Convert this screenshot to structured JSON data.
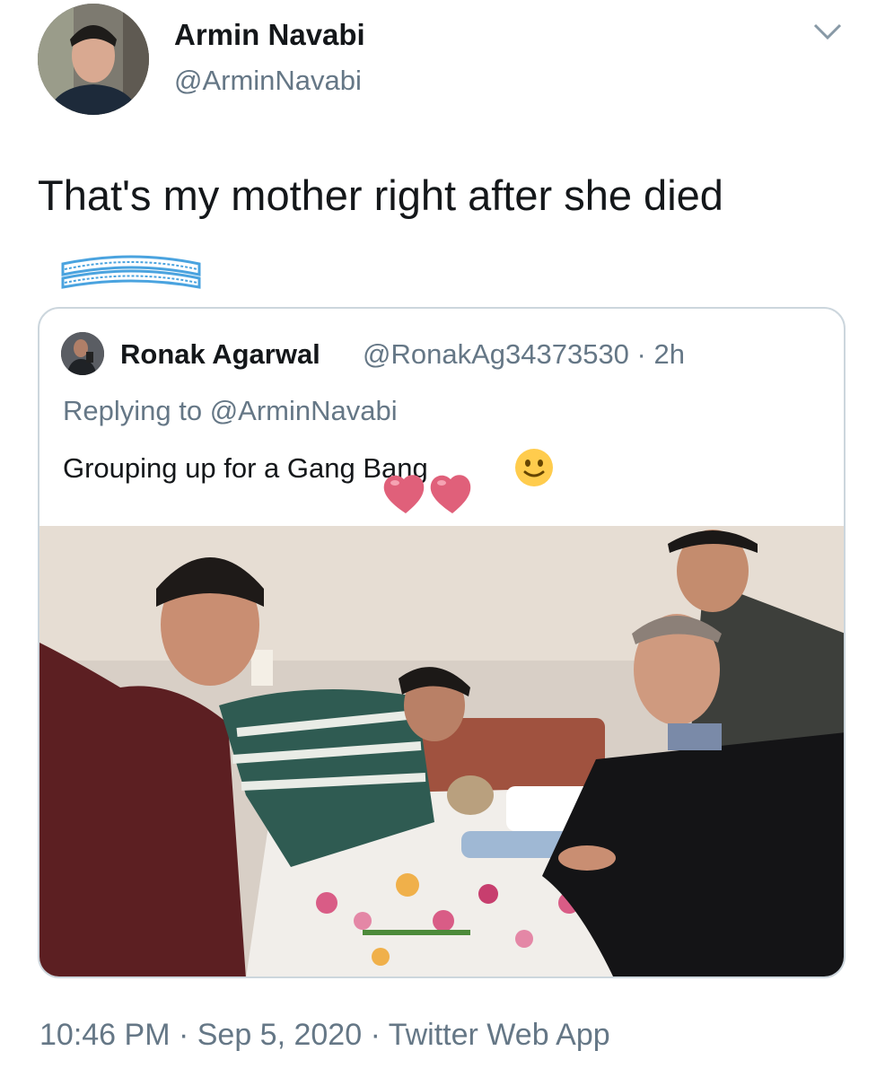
{
  "author": {
    "name": "Armin Navabi",
    "handle": "@ArminNavabi",
    "avatar_icon": "profile-photo"
  },
  "menu_icon": "chevron-down-icon",
  "tweet": {
    "text": "That's my mother right after she died"
  },
  "quoted_tweet": {
    "author_name": "Ronak Agarwal",
    "meta": "@RonakAg34373530 · 2h",
    "replying_to": "Replying to @ArminNavabi",
    "text": "Grouping up for a Gang Bang",
    "emoji": "slightly-smiling-face",
    "sticker": "two-pink-hearts",
    "image_description_icon": "attached-photo"
  },
  "footer": {
    "time_date": "10:46 PM · Sep 5, 2020 · ",
    "app": "Twitter Web App"
  },
  "colors": {
    "primary_text": "#14171a",
    "secondary_text": "#657786",
    "border": "#ccd6dd",
    "scribble_blue": "#4aa3df",
    "heart_pink": "#e0607a"
  }
}
